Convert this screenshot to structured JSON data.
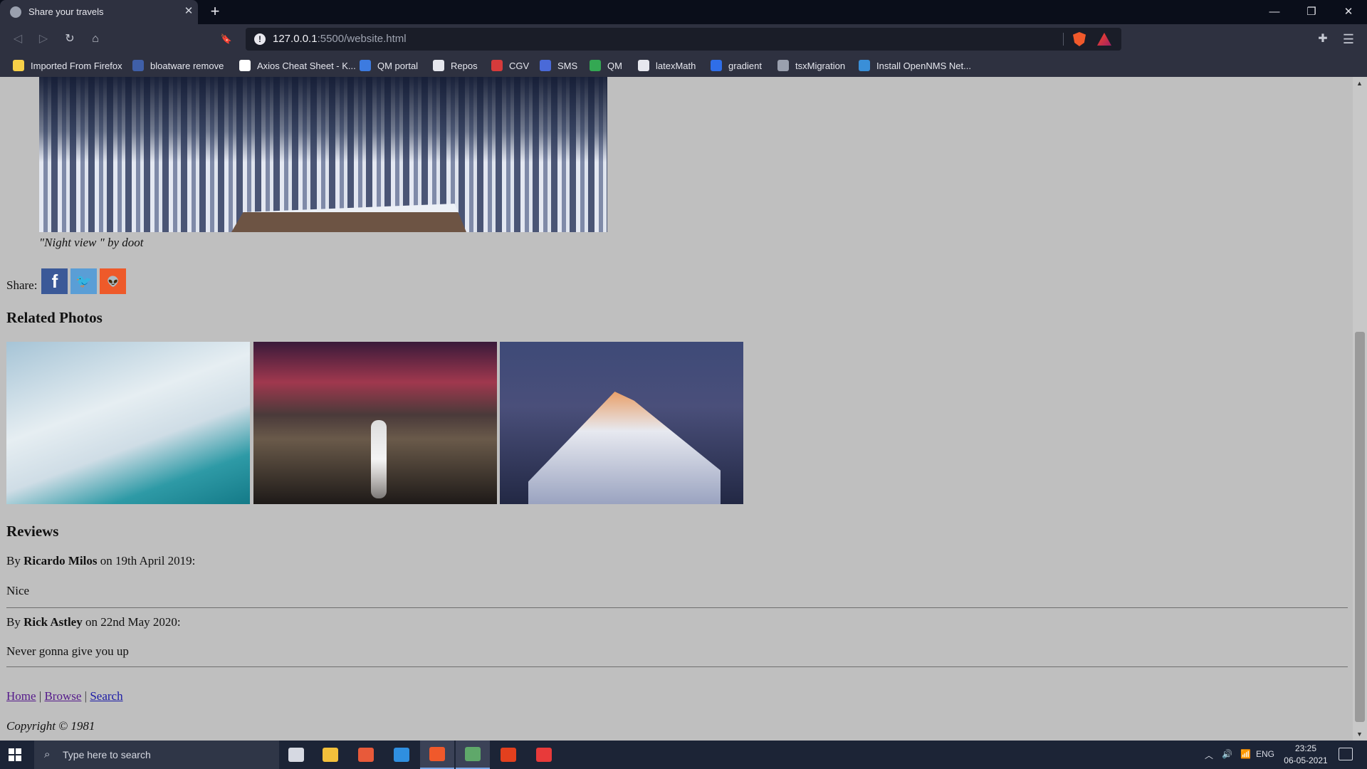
{
  "browser": {
    "tab_title": "Share your travels",
    "tab_close": "✕",
    "new_tab": "+",
    "url_host": "127.0.0.1",
    "url_rest": ":5500/website.html",
    "nav": {
      "back": "◁",
      "forward": "▷",
      "reload": "↻",
      "home": "⌂",
      "bookmark": "🔖"
    },
    "window": {
      "minimize": "—",
      "restore": "❐",
      "close": "✕"
    },
    "bookmarks": [
      {
        "label": "Imported From Firefox",
        "icon": "folder-icon",
        "color": "#f7d048"
      },
      {
        "label": "bloatware remove",
        "icon": "xda-icon",
        "color": "#3f5fa8"
      },
      {
        "label": "Axios Cheat Sheet - K...",
        "icon": "kapeli-icon",
        "color": "#ffffff"
      },
      {
        "label": "QM portal",
        "icon": "qm-icon",
        "color": "#3d7be0"
      },
      {
        "label": "Repos",
        "icon": "github-icon",
        "color": "#e6e7ee"
      },
      {
        "label": "CGV",
        "icon": "cgv-icon",
        "color": "#d63b3b"
      },
      {
        "label": "SMS",
        "icon": "sms-icon",
        "color": "#4a6ad8"
      },
      {
        "label": "QM",
        "icon": "drive-icon",
        "color": "#34a853"
      },
      {
        "label": "latexMath",
        "icon": "github-icon",
        "color": "#e6e7ee"
      },
      {
        "label": "gradient",
        "icon": "gradient-icon",
        "color": "#2f6ee8"
      },
      {
        "label": "tsxMigration",
        "icon": "link-icon",
        "color": "#9aa0ae"
      },
      {
        "label": "Install OpenNMS Net...",
        "icon": "opennms-icon",
        "color": "#3a8fd8"
      }
    ]
  },
  "page": {
    "caption": "\"Night view \" by doot",
    "share_label": "Share:",
    "share_buttons": [
      {
        "glyph": "f",
        "icon": "facebook-icon"
      },
      {
        "glyph": "🐦",
        "icon": "twitter-icon"
      },
      {
        "glyph": "👽",
        "icon": "reddit-icon"
      }
    ],
    "related_title": "Related Photos",
    "reviews_title": "Reviews",
    "reviews": [
      {
        "prefix": "By ",
        "author": "Ricardo Milos",
        "date_text": " on 19th April 2019:",
        "text": "Nice"
      },
      {
        "prefix": "By ",
        "author": "Rick Astley",
        "date_text": " on 22nd May 2020:",
        "text": "Never gonna give you up"
      }
    ],
    "footer": {
      "home": "Home",
      "browse": "Browse",
      "search": "Search",
      "sep": "|"
    },
    "copyright": "Copyright © 1981"
  },
  "taskbar": {
    "search_placeholder": "Type here to search",
    "language": "ENG",
    "time": "23:25",
    "date": "06-05-2021",
    "apps": [
      {
        "icon": "task-view-icon",
        "color": "#d6d9e2"
      },
      {
        "icon": "file-explorer-icon",
        "color": "#f3c03b"
      },
      {
        "icon": "chrome-icon",
        "color": "#e85a3a"
      },
      {
        "icon": "vscode-icon",
        "color": "#2f8fe0"
      },
      {
        "icon": "brave-icon",
        "color": "#f0592b"
      },
      {
        "icon": "app-icon",
        "color": "#5fa86a"
      },
      {
        "icon": "office-icon",
        "color": "#e3401e"
      },
      {
        "icon": "lifebuoy-icon",
        "color": "#e83a3a"
      }
    ]
  }
}
